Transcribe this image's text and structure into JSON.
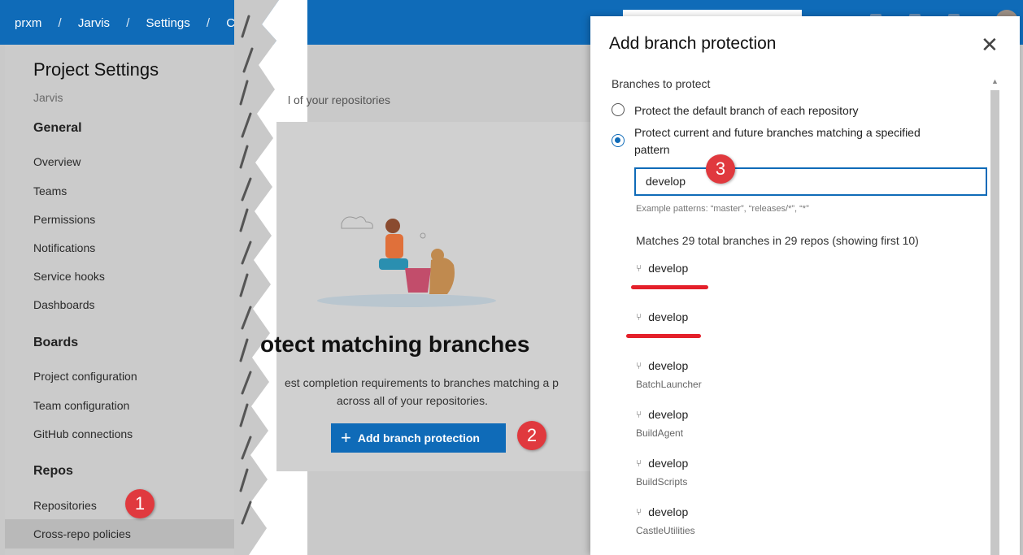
{
  "breadcrumb": {
    "items": [
      "prxm",
      "Jarvis",
      "Settings",
      "Cros"
    ],
    "separator": "/"
  },
  "sidebar": {
    "title": "Project Settings",
    "project": "Jarvis",
    "sections": {
      "general": "General",
      "boards": "Boards",
      "repos": "Repos"
    },
    "general_items": [
      "Overview",
      "Teams",
      "Permissions",
      "Notifications",
      "Service hooks",
      "Dashboards"
    ],
    "boards_items": [
      "Project configuration",
      "Team configuration",
      "GitHub connections"
    ],
    "repos_items": [
      "Repositories",
      "Cross-repo policies"
    ]
  },
  "main": {
    "description": "l of your repositories",
    "empty_title": "otect matching branches",
    "empty_line1": "est completion requirements to branches matching a p",
    "empty_line2": "across all of your repositories.",
    "add_button": "Add branch protection"
  },
  "callouts": {
    "one": "1",
    "two": "2",
    "three": "3"
  },
  "panel": {
    "title": "Add branch protection",
    "close_icon": "close-icon",
    "branches_label": "Branches to protect",
    "option_default": "Protect the default branch of each repository",
    "option_pattern_line1": "Protect current and future branches matching a specified",
    "option_pattern_line2": "pattern",
    "pattern_value": "develop",
    "hint": "Example patterns: “master”, “releases/*”, “*”",
    "matches": "Matches 29 total branches in 29 repos (showing first 10)",
    "branches": [
      {
        "name": "develop",
        "repo": ""
      },
      {
        "name": "develop",
        "repo": ""
      },
      {
        "name": "develop",
        "repo": "BatchLauncher"
      },
      {
        "name": "develop",
        "repo": "BuildAgent"
      },
      {
        "name": "develop",
        "repo": "BuildScripts"
      },
      {
        "name": "develop",
        "repo": "CastleUtilities"
      }
    ]
  },
  "colors": {
    "accent": "#0f6bb8",
    "callout": "#e0393e",
    "redaction": "#e4202a"
  }
}
